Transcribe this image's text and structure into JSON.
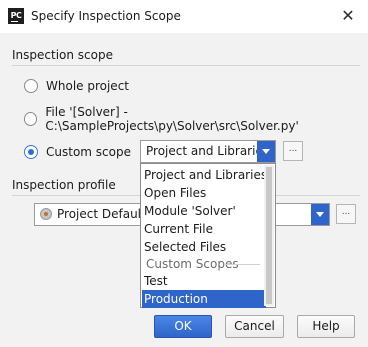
{
  "window": {
    "title": "Specify Inspection Scope",
    "app_icon_text": "PC"
  },
  "scope": {
    "heading": "Inspection scope",
    "options": [
      {
        "label": "Whole project",
        "checked": false
      },
      {
        "label": "File '[Solver] - C:\\SampleProjects\\py\\Solver\\src\\Solver.py'",
        "checked": false
      },
      {
        "label": "Custom scope",
        "checked": true
      }
    ],
    "custom_value": "Project and Libraries",
    "ellipsis": "..."
  },
  "dropdown": {
    "items": [
      {
        "label": "Project and Libraries",
        "type": "item"
      },
      {
        "label": "Open Files",
        "type": "item"
      },
      {
        "label": "Module 'Solver'",
        "type": "item"
      },
      {
        "label": "Current File",
        "type": "item"
      },
      {
        "label": "Selected Files",
        "type": "item"
      },
      {
        "label": "Custom Scopes",
        "type": "group"
      },
      {
        "label": "Test",
        "type": "item"
      },
      {
        "label": "Production",
        "type": "item",
        "selected": true
      }
    ]
  },
  "profile": {
    "heading": "Inspection profile",
    "value": "Project Default",
    "ellipsis": "..."
  },
  "buttons": {
    "ok": "OK",
    "cancel": "Cancel",
    "help": "Help"
  },
  "colors": {
    "accent": "#2f65ca",
    "dialog_bg": "#f2f2f2"
  }
}
